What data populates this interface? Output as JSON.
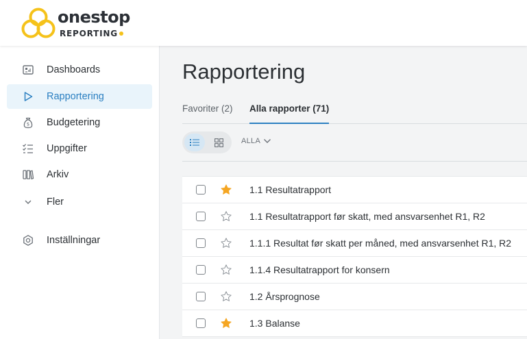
{
  "brand": {
    "name": "onestop",
    "sub": "REPORTING"
  },
  "sidebar": {
    "items": [
      {
        "label": "Dashboards",
        "icon": "dashboard-icon"
      },
      {
        "label": "Rapportering",
        "icon": "play-icon",
        "active": true
      },
      {
        "label": "Budgetering",
        "icon": "money-bag-icon"
      },
      {
        "label": "Uppgifter",
        "icon": "checklist-icon"
      },
      {
        "label": "Arkiv",
        "icon": "archive-icon"
      },
      {
        "label": "Fler",
        "icon": "chevron-down-icon"
      },
      {
        "label": "Inställningar",
        "icon": "gear-icon"
      }
    ]
  },
  "main": {
    "title": "Rapportering",
    "tabs": [
      {
        "label": "Favoriter (2)"
      },
      {
        "label": "Alla rapporter (71)",
        "active": true
      }
    ],
    "toolbar": {
      "filter_label": "ALLA",
      "view": "list"
    },
    "reports": [
      {
        "name": "1.1 Resultatrapport",
        "favorite": true
      },
      {
        "name": "1.1 Resultatrapport før skatt, med ansvarsenhet R1, R2",
        "favorite": false
      },
      {
        "name": "1.1.1 Resultat før skatt per måned, med ansvarsenhet R1, R2",
        "favorite": false
      },
      {
        "name": "1.1.4 Resultatrapport for konsern",
        "favorite": false
      },
      {
        "name": "1.2 Årsprognose",
        "favorite": false
      },
      {
        "name": "1.3 Balanse",
        "favorite": true
      }
    ]
  },
  "colors": {
    "accent": "#2a7fc1",
    "star_filled": "#f5a623",
    "logo_yellow": "#f5c21a"
  }
}
